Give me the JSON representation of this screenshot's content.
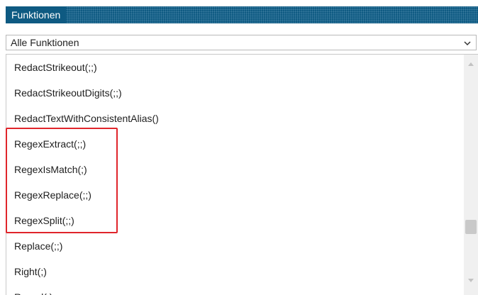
{
  "header": {
    "title": "Funktionen"
  },
  "filter": {
    "selected": "Alle Funktionen",
    "icon": "chevron-down-icon"
  },
  "functions": {
    "items": [
      "RedactStrikeout(;;)",
      "RedactStrikeoutDigits(;;)",
      "RedactTextWithConsistentAlias()",
      "RegexExtract(;;)",
      "RegexIsMatch(;)",
      "RegexReplace(;;)",
      "RegexSplit(;;)",
      "Replace(;;)",
      "Right(;)",
      "Round(;)"
    ]
  },
  "highlight": {
    "color": "#e0252b",
    "items": [
      "RegexExtract(;;)",
      "RegexIsMatch(;)",
      "RegexReplace(;;)",
      "RegexSplit(;;)"
    ]
  },
  "colors": {
    "title_bar": "#0e5a82",
    "highlight": "#e0252b"
  },
  "scrollbar": {
    "position": 0.62
  }
}
